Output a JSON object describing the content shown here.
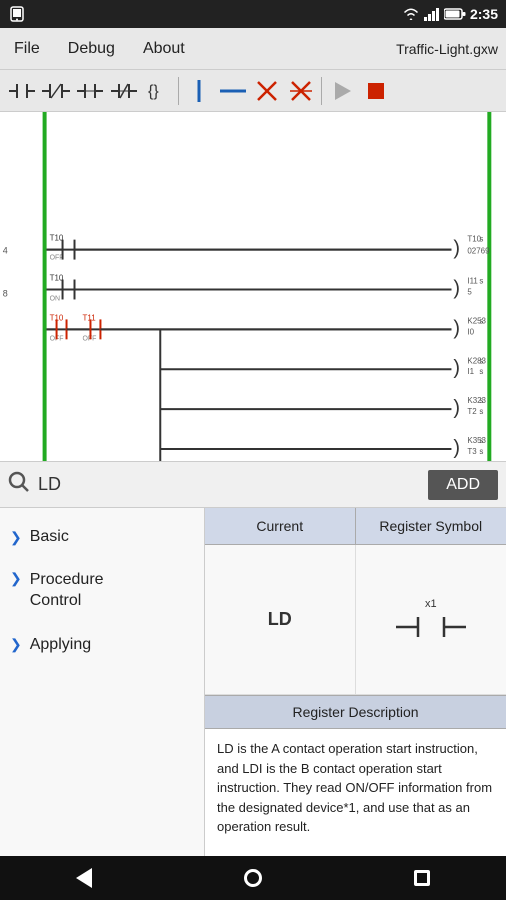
{
  "status_bar": {
    "time": "2:35",
    "icons": [
      "signal",
      "wifi",
      "battery"
    ]
  },
  "menu": {
    "file": "File",
    "debug": "Debug",
    "about": "About",
    "title": "Traffic-Light.gxw"
  },
  "toolbar": {
    "buttons": [
      "NO-contact",
      "NP-contact",
      "NC-contact",
      "NI-contact",
      "special-contact",
      "vertical-line",
      "horizontal-line",
      "delete-x",
      "delete-x2",
      "play",
      "stop"
    ]
  },
  "search": {
    "value": "LD",
    "add_label": "ADD"
  },
  "categories": [
    {
      "id": "basic",
      "label": "Basic"
    },
    {
      "id": "procedure-control",
      "label": "Procedure\nControl"
    },
    {
      "id": "applying",
      "label": "Applying"
    }
  ],
  "symbol_table": {
    "col_current": "Current",
    "col_register": "Register Symbol",
    "current_value": "LD",
    "register_label": "x1"
  },
  "description": {
    "header": "Register Description",
    "text": "LD is the A contact operation start instruction, and LDI is the B contact operation start instruction. They read ON/OFF information from the designated device*1, and use that as an operation result."
  },
  "nav": {
    "back": "back",
    "home": "home",
    "recent": "recent"
  }
}
